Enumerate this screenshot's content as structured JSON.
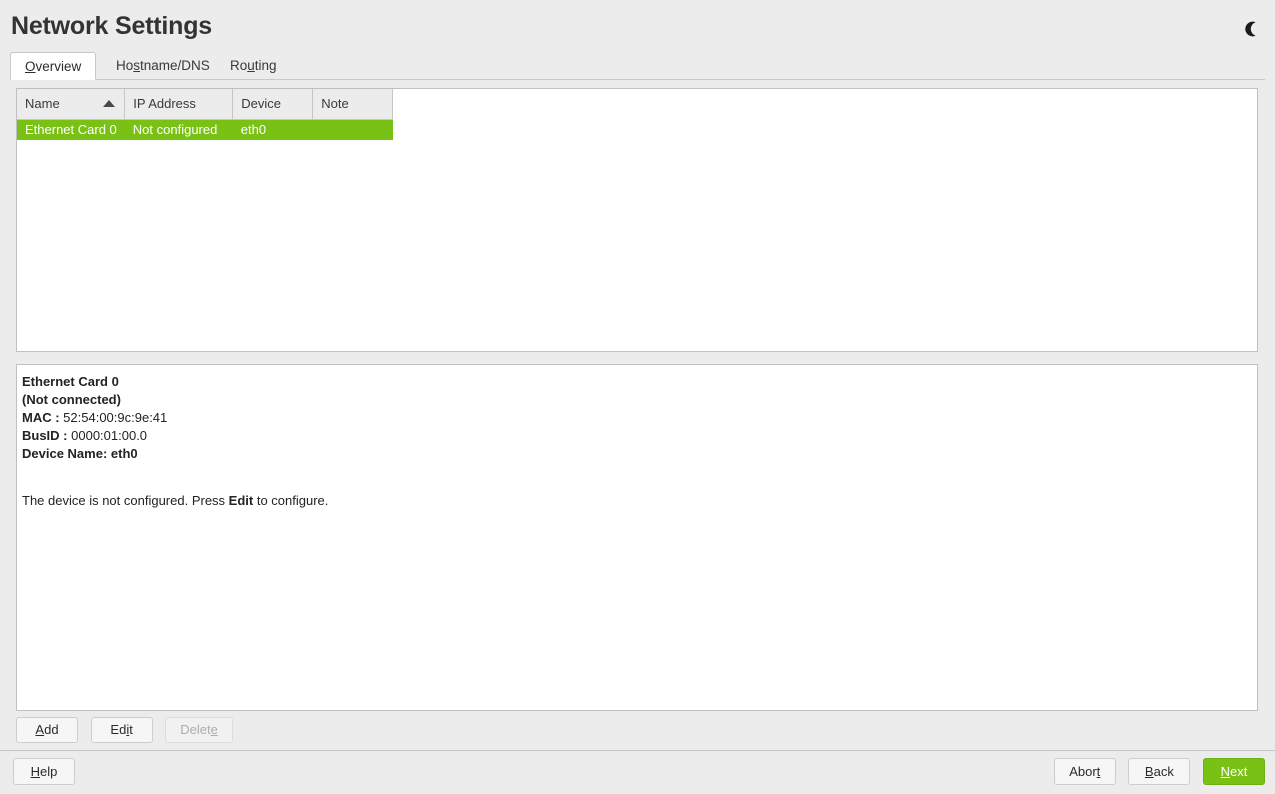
{
  "window": {
    "title": "Network Settings",
    "theme_toggle_icon": "moon-icon"
  },
  "tabs": [
    {
      "label": "Overview",
      "mnemonic": "O",
      "active": true
    },
    {
      "label": "Hostname/DNS",
      "mnemonic": "s",
      "active": false
    },
    {
      "label": "Routing",
      "mnemonic": "u",
      "active": false
    }
  ],
  "table": {
    "columns": [
      {
        "label": "Name",
        "width": 94,
        "sorted": true,
        "sort_direction": "ascending"
      },
      {
        "label": "IP Address",
        "width": 108,
        "sorted": false
      },
      {
        "label": "Device",
        "width": 80,
        "sorted": false
      },
      {
        "label": "Note",
        "width": 80,
        "sorted": false
      }
    ],
    "rows": [
      {
        "name": "Ethernet Card 0",
        "ip_address": "Not configured",
        "device": "eth0",
        "note": "",
        "selected": true
      }
    ],
    "selected_color": "#7ac116"
  },
  "detail": {
    "card_name": "Ethernet Card 0",
    "connection_state": "(Not connected)",
    "mac_label": "MAC :",
    "mac_value": "52:54:00:9c:9e:41",
    "busid_label": "BusID :",
    "busid_value": "0000:01:00.0",
    "device_name_line": "Device Name: eth0",
    "message_pre": "The device is not configured. Press ",
    "message_bold": "Edit",
    "message_post": " to configure."
  },
  "actions": {
    "add": {
      "label": "Add",
      "mnemonic": "A",
      "enabled": true
    },
    "edit": {
      "label": "Edit",
      "mnemonic": "i",
      "enabled": true
    },
    "delete": {
      "label": "Delete",
      "mnemonic": "e",
      "enabled": false
    }
  },
  "footer": {
    "help": {
      "label": "Help",
      "mnemonic": "H"
    },
    "abort": {
      "label": "Abort",
      "mnemonic": "t"
    },
    "back": {
      "label": "Back",
      "mnemonic": "B"
    },
    "next": {
      "label": "Next",
      "mnemonic": "N",
      "primary": true,
      "color": "#7ac116"
    }
  }
}
